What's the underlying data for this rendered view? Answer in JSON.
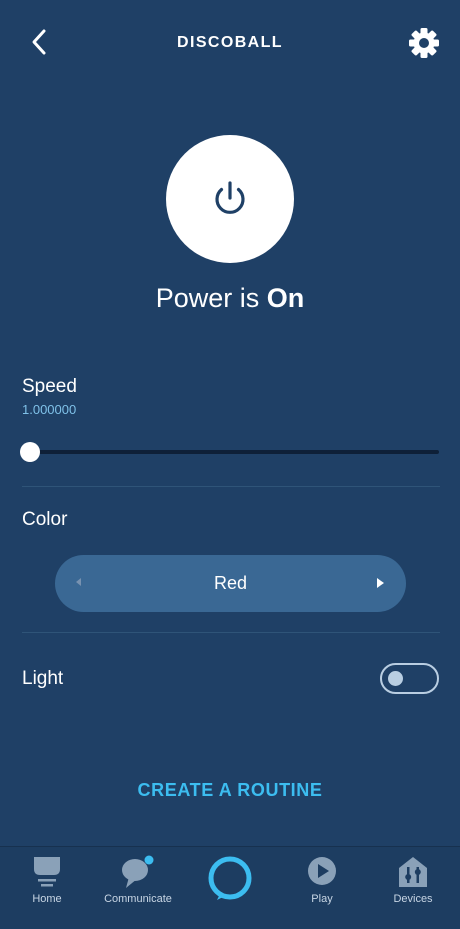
{
  "header": {
    "title": "DISCOBALL",
    "back_icon": "back-chevron-icon",
    "settings_icon": "gear-icon"
  },
  "power": {
    "icon": "power-icon",
    "status_prefix": "Power is ",
    "status_value": "On"
  },
  "speed": {
    "label": "Speed",
    "value": "1.000000",
    "slider_fraction": 0
  },
  "color": {
    "label": "Color",
    "selected": "Red",
    "prev_icon": "arrow-left-icon",
    "next_icon": "arrow-right-icon"
  },
  "light": {
    "label": "Light",
    "on": false
  },
  "routine": {
    "label": "CREATE A ROUTINE"
  },
  "nav": {
    "items": [
      {
        "label": "Home",
        "icon": "home-icon"
      },
      {
        "label": "Communicate",
        "icon": "chat-bubble-icon"
      },
      {
        "label": "",
        "icon": "alexa-ring-icon"
      },
      {
        "label": "Play",
        "icon": "play-icon"
      },
      {
        "label": "Devices",
        "icon": "devices-icon"
      }
    ]
  },
  "colors": {
    "background": "#1f4066",
    "accent": "#3cbdf0",
    "speed_value": "#7fc1e8",
    "picker": "#3a6894"
  }
}
